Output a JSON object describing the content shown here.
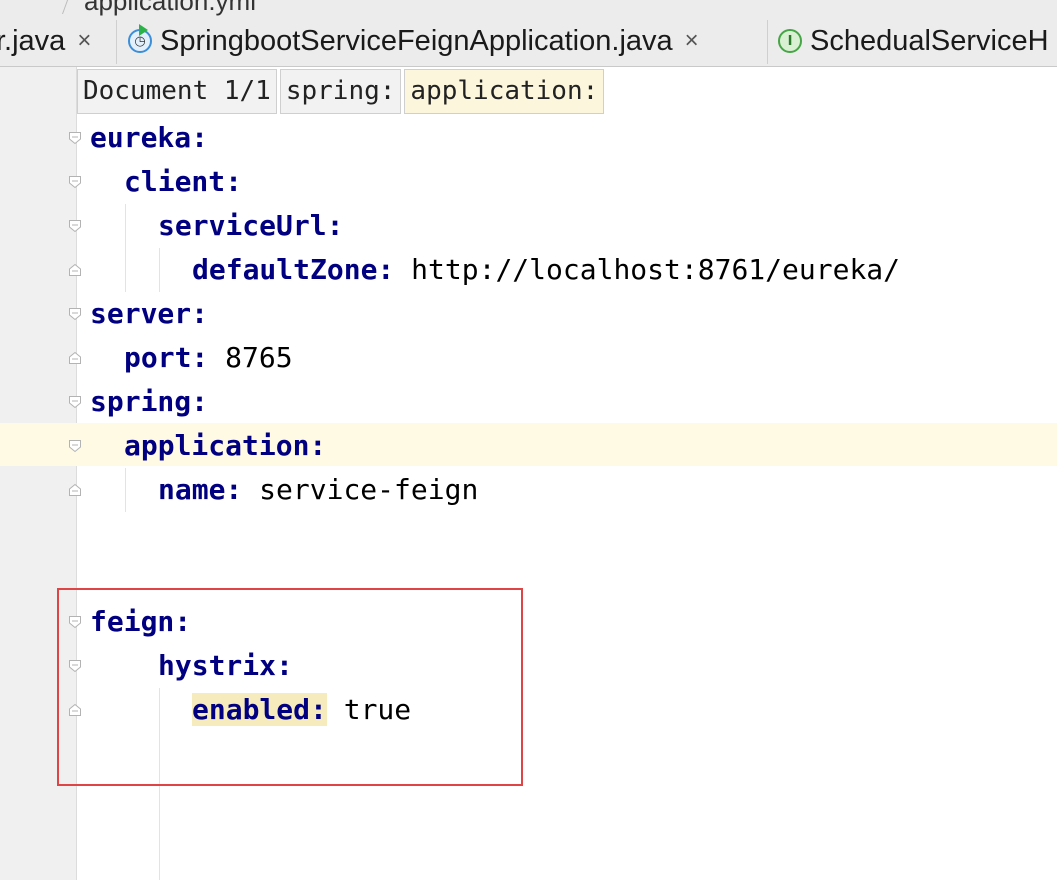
{
  "top_breadcrumb": {
    "file": "application.yml"
  },
  "tabs": [
    {
      "label": "r.java",
      "icon": "none",
      "closable": true
    },
    {
      "label": "SpringbootServiceFeignApplication.java",
      "icon": "spring-boot-run-class-icon",
      "closable": true
    },
    {
      "label": "SchedualServiceH",
      "icon": "interface-icon",
      "closable": false
    }
  ],
  "close_glyph": "×",
  "interface_glyph": "I",
  "yaml_path": [
    {
      "label": "Document 1/1",
      "active": false
    },
    {
      "label": "spring:",
      "active": false
    },
    {
      "label": "application:",
      "active": true
    }
  ],
  "code_lines": [
    {
      "key": "eureka:",
      "value": "",
      "indent": 0
    },
    {
      "key": "client:",
      "value": "",
      "indent": 1
    },
    {
      "key": "serviceUrl:",
      "value": "",
      "indent": 2
    },
    {
      "key": "defaultZone:",
      "value": "http://localhost:8761/eureka/",
      "indent": 3
    },
    {
      "key": "server:",
      "value": "",
      "indent": 0
    },
    {
      "key": "port:",
      "value": "8765",
      "indent": 1
    },
    {
      "key": "spring:",
      "value": "",
      "indent": 0
    },
    {
      "key": "application:",
      "value": "",
      "indent": 1
    },
    {
      "key": "name:",
      "value": "service-feign",
      "indent": 2
    },
    {
      "key": "",
      "value": "",
      "indent": 0
    },
    {
      "key": "",
      "value": "",
      "indent": 0
    },
    {
      "key": "feign:",
      "value": "",
      "indent": 0
    },
    {
      "key": "hystrix:",
      "value": "",
      "indent": 2
    },
    {
      "key": "enabled:",
      "value": "true",
      "indent": 3,
      "highlight": true
    }
  ],
  "colors": {
    "yaml_key": "#000080",
    "caret_line": "#fffae3",
    "annotation_box": "#e04545",
    "key_highlight": "#f6ebbc"
  }
}
